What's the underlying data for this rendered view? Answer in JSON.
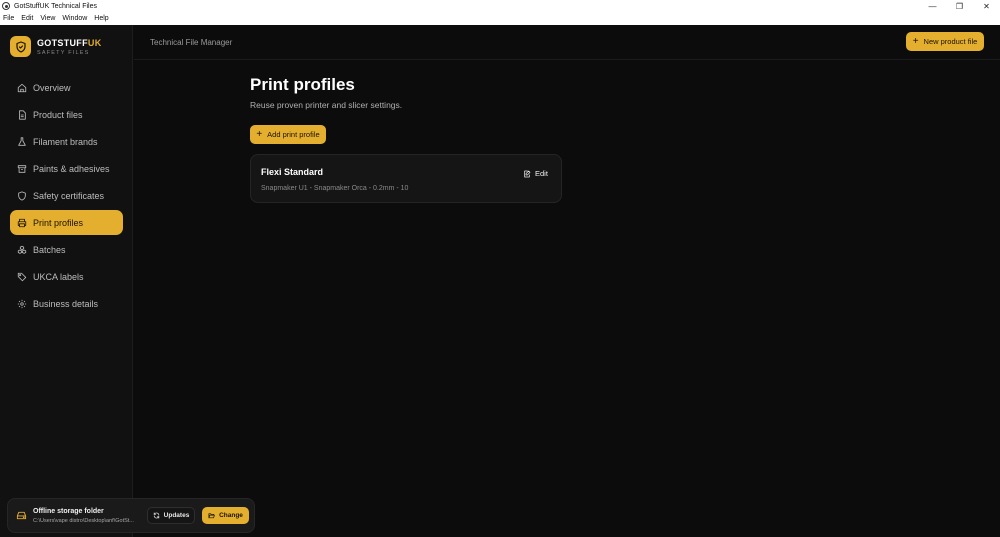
{
  "window": {
    "title": "GotStuffUK Technical Files",
    "controls": {
      "minimize": "—",
      "restore": "❐",
      "close": "✕"
    }
  },
  "menubar": [
    "File",
    "Edit",
    "View",
    "Window",
    "Help"
  ],
  "brand": {
    "name_main": "GOTSTUFF",
    "name_accent": "UK",
    "subtitle": "SAFETY FILES"
  },
  "sidebar": {
    "items": [
      {
        "label": "Overview",
        "icon": "home-icon"
      },
      {
        "label": "Product files",
        "icon": "file-icon"
      },
      {
        "label": "Filament brands",
        "icon": "flask-icon"
      },
      {
        "label": "Paints & adhesives",
        "icon": "archive-icon"
      },
      {
        "label": "Safety certificates",
        "icon": "shield-icon"
      },
      {
        "label": "Print profiles",
        "icon": "printer-icon",
        "active": true
      },
      {
        "label": "Batches",
        "icon": "boxes-icon"
      },
      {
        "label": "UKCA labels",
        "icon": "tag-icon"
      },
      {
        "label": "Business details",
        "icon": "gear-icon"
      }
    ]
  },
  "storage": {
    "title": "Offline storage folder",
    "path": "C:\\Users\\vape distro\\Desktop\\anf\\GotSt...",
    "updates_label": "Updates",
    "change_label": "Change"
  },
  "header": {
    "title": "Technical File Manager",
    "new_button": "New product file"
  },
  "main": {
    "title": "Print profiles",
    "subtitle": "Reuse proven printer and slicer settings.",
    "add_button": "Add print profile",
    "profiles": [
      {
        "name": "Flexi Standard",
        "meta": "Snapmaker U1 - Snapmaker Orca - 0.2mm - 10",
        "edit_label": "Edit"
      }
    ]
  },
  "colors": {
    "accent": "#e4ae2f",
    "background": "#0c0c0c",
    "sidebar": "#111111",
    "card": "#151515"
  }
}
